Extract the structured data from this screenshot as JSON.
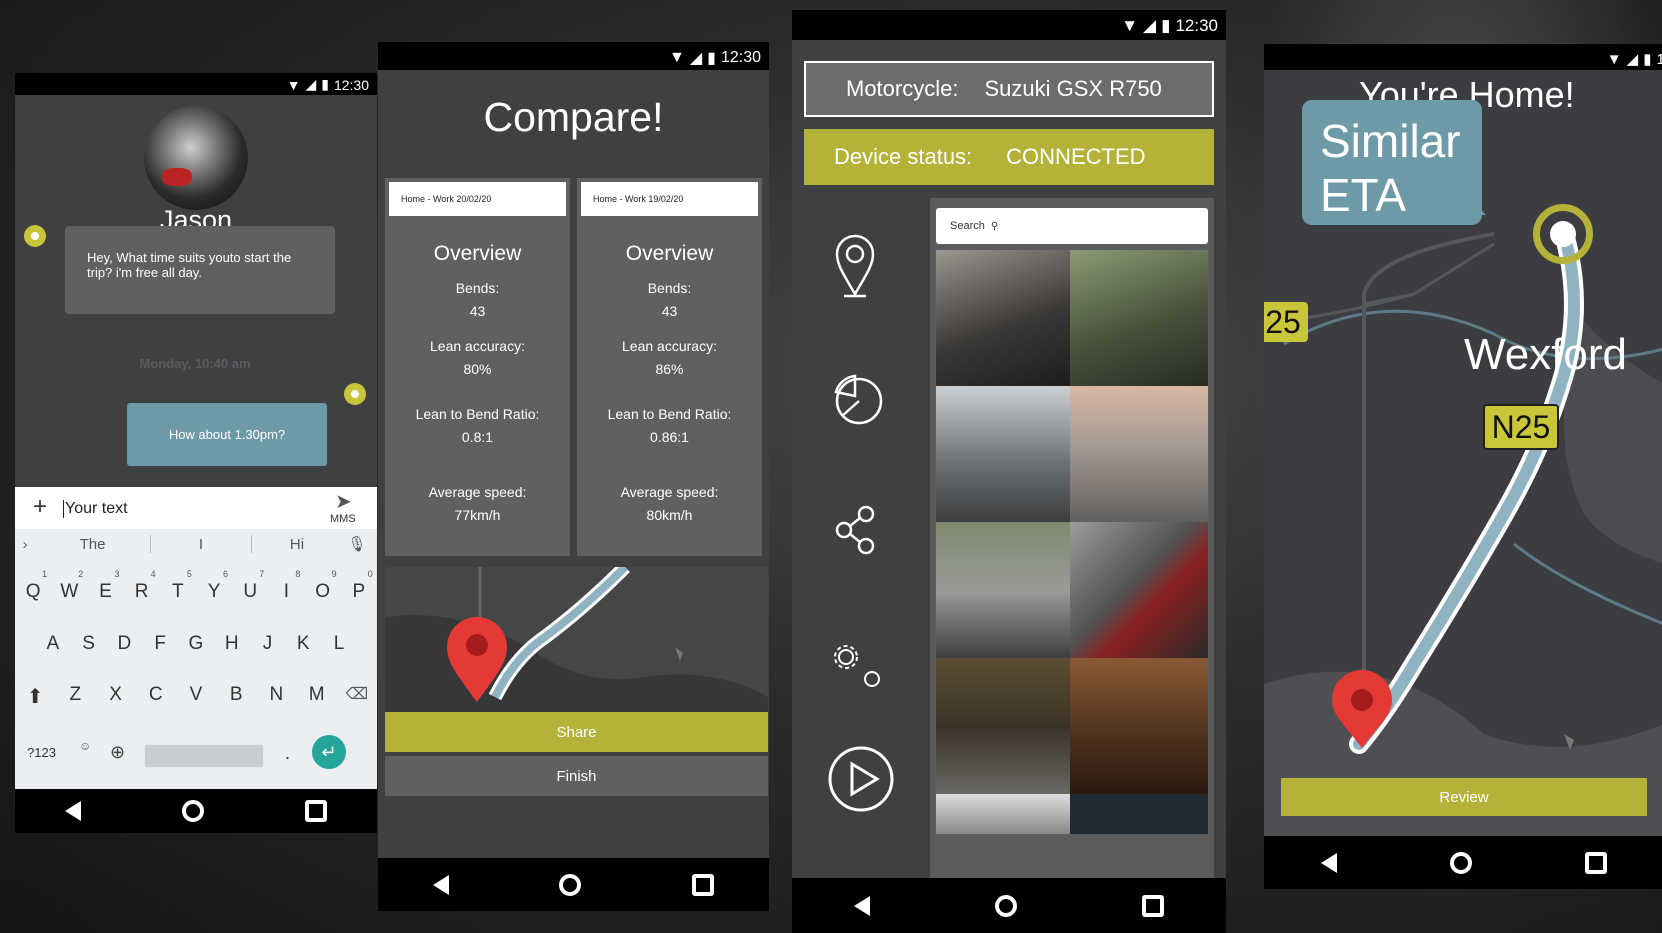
{
  "status": {
    "time": "12:30"
  },
  "chat": {
    "contact_name": "Jason",
    "incoming_message": "Hey, What time suits youto start the trip? i'm free all day.",
    "timestamp": "Monday, 10:40 am",
    "outgoing_message": "How about 1.30pm?",
    "input_placeholder": "Your text",
    "send_label": "MMS",
    "suggestions": [
      "The",
      "I",
      "Hi"
    ],
    "keyboard_rows": [
      [
        "Q",
        "W",
        "E",
        "R",
        "T",
        "Y",
        "U",
        "I",
        "O",
        "P"
      ],
      [
        "A",
        "S",
        "D",
        "F",
        "G",
        "H",
        "J",
        "K",
        "L"
      ],
      [
        "Z",
        "X",
        "C",
        "V",
        "B",
        "N",
        "M"
      ]
    ],
    "number_hints": [
      "1",
      "2",
      "3",
      "4",
      "5",
      "6",
      "7",
      "8",
      "9",
      "0"
    ],
    "symbols_key": "?123",
    "period_key": "."
  },
  "compare": {
    "title": "Compare!",
    "cards": [
      {
        "tab": "Home - Work 20/02/20",
        "heading": "Overview",
        "bends_label": "Bends:",
        "bends": "43",
        "lean_label": "Lean accuracy:",
        "lean": "80%",
        "ratio_label": "Lean to Bend Ratio:",
        "ratio": "0.8:1",
        "speed_label": "Average speed:",
        "speed": "77km/h"
      },
      {
        "tab": "Home - Work 19/02/20",
        "heading": "Overview",
        "bends_label": "Bends:",
        "bends": "43",
        "lean_label": "Lean accuracy:",
        "lean": "86%",
        "ratio_label": "Lean to Bend Ratio:",
        "ratio": "0.86:1",
        "speed_label": "Average speed:",
        "speed": "80km/h"
      }
    ],
    "share_label": "Share",
    "finish_label": "Finish"
  },
  "device": {
    "moto_label": "Motorcycle:",
    "moto_value": "Suzuki GSX R750",
    "status_label": "Device status:",
    "status_value": "CONNECTED",
    "search_placeholder": "Search"
  },
  "home": {
    "title": "You're Home!",
    "bubble_line1": "Similar",
    "bubble_line2": "ETA",
    "place": "Wexford",
    "road_left": "25",
    "road_main": "N25",
    "review_label": "Review"
  },
  "colors": {
    "olive": "#b5b23a",
    "teal": "#6e9aa8",
    "route": "#8fb3c1",
    "pin": "#e53935"
  }
}
